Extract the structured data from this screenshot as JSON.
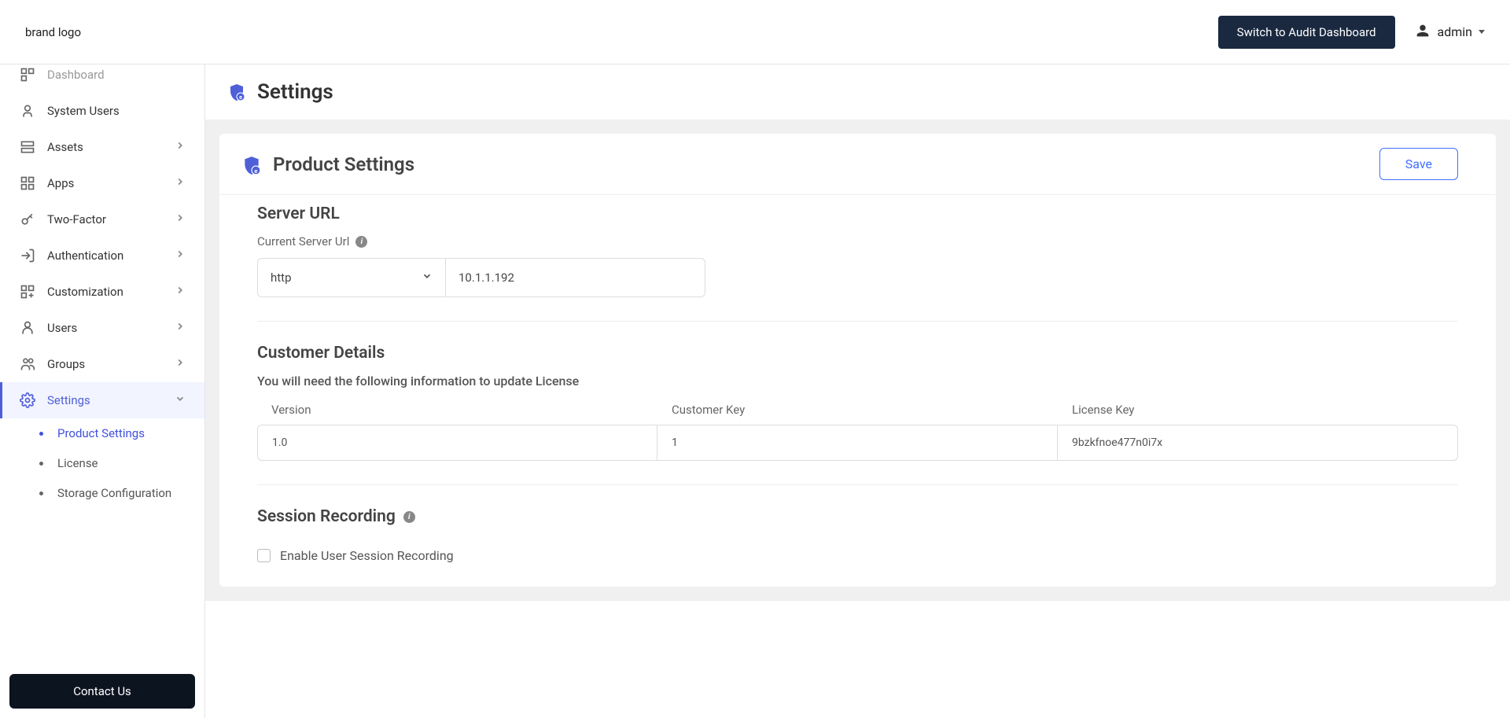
{
  "header": {
    "brand_text": "brand logo",
    "switch_button": "Switch to Audit Dashboard",
    "username": "admin"
  },
  "sidebar": {
    "items": [
      {
        "label": "Dashboard",
        "expandable": false
      },
      {
        "label": "System Users",
        "expandable": false
      },
      {
        "label": "Assets",
        "expandable": true
      },
      {
        "label": "Apps",
        "expandable": true
      },
      {
        "label": "Two-Factor",
        "expandable": true
      },
      {
        "label": "Authentication",
        "expandable": true
      },
      {
        "label": "Customization",
        "expandable": true
      },
      {
        "label": "Users",
        "expandable": true
      },
      {
        "label": "Groups",
        "expandable": true
      },
      {
        "label": "Settings",
        "expandable": true,
        "active": true
      }
    ],
    "sub_items": [
      {
        "label": "Product Settings",
        "active": true
      },
      {
        "label": "License"
      },
      {
        "label": "Storage Configuration"
      }
    ],
    "contact_button": "Contact Us"
  },
  "page": {
    "title": "Settings",
    "card_title": "Product Settings",
    "save_button": "Save",
    "server_url": {
      "title": "Server URL",
      "label": "Current Server Url",
      "protocol": "http",
      "host": "10.1.1.192"
    },
    "customer_details": {
      "title": "Customer Details",
      "subtext": "You will need the following information to update License",
      "columns": {
        "version": {
          "header": "Version",
          "value": "1.0"
        },
        "customer_key": {
          "header": "Customer Key",
          "value": "1"
        },
        "license_key": {
          "header": "License Key",
          "value": "9bzkfnoe477n0i7x"
        }
      }
    },
    "session": {
      "title": "Session Recording",
      "checkbox_label": "Enable User Session Recording"
    }
  }
}
